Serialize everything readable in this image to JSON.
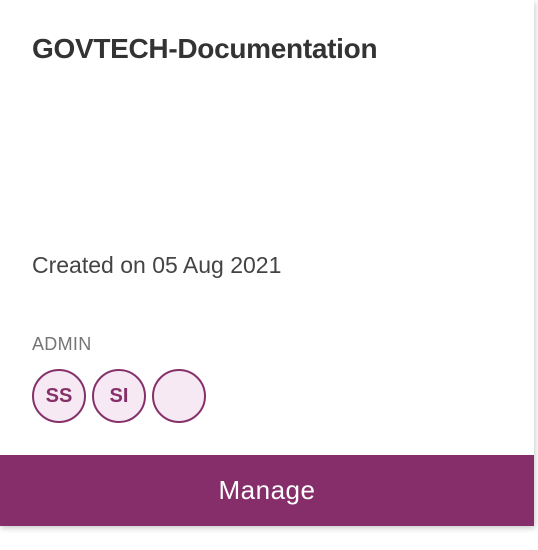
{
  "card": {
    "title": "GOVTECH-Documentation",
    "created_text": "Created on 05 Aug 2021",
    "admin_label": "ADMIN",
    "admins": [
      {
        "initials": "SS"
      },
      {
        "initials": "SI"
      },
      {
        "initials": ""
      }
    ],
    "manage_label": "Manage"
  },
  "colors": {
    "accent": "#862e69",
    "avatar_bg": "#f6e9f3",
    "title_text": "#333333",
    "muted_text": "#757575"
  }
}
